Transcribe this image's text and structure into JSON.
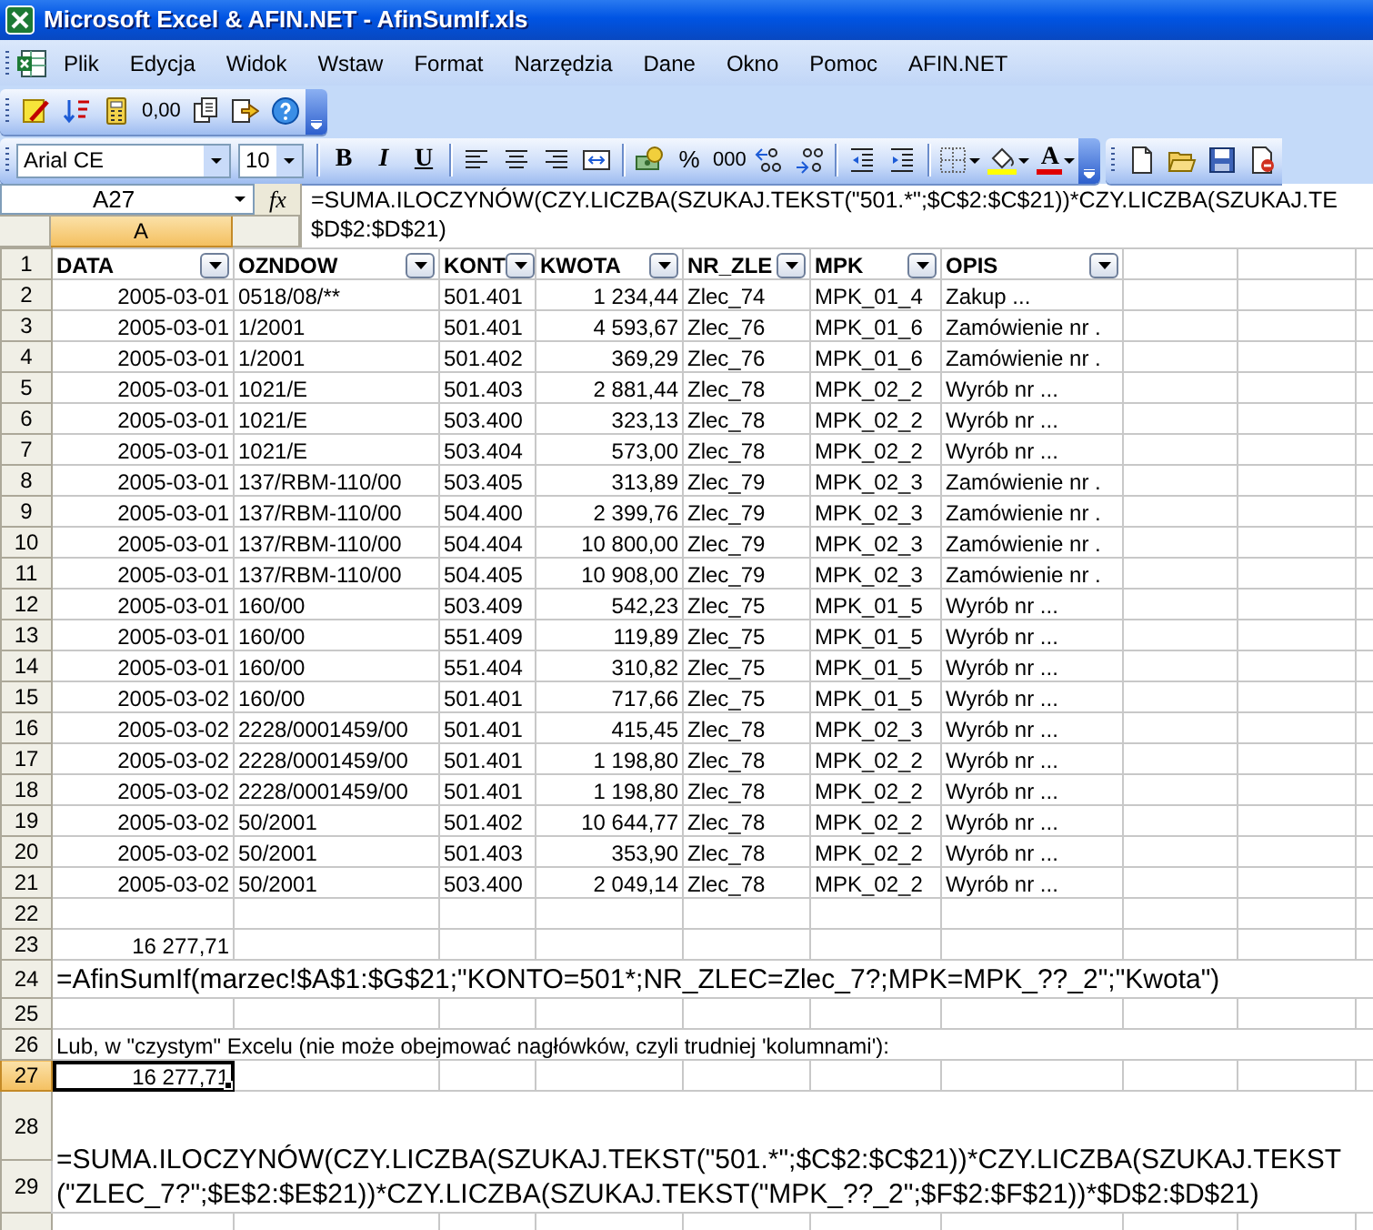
{
  "window": {
    "title": "Microsoft Excel & AFIN.NET - AfinSumIf.xls"
  },
  "menu": {
    "items": [
      "Plik",
      "Edycja",
      "Widok",
      "Wstaw",
      "Format",
      "Narzędzia",
      "Dane",
      "Okno",
      "Pomoc",
      "AFIN.NET"
    ]
  },
  "auditing_toolbar": {
    "number_format_button": "0,00"
  },
  "formatting_toolbar": {
    "font": "Arial CE",
    "font_size": "10",
    "bold_button": "B",
    "italic_button": "I",
    "underline_button": "U",
    "percent_button": "%",
    "thousands_button": "000",
    "font_color_button": "A"
  },
  "formula_bar": {
    "name_box": "A27",
    "fx_label": "fx",
    "formula_lines": [
      "=SUMA.ILOCZYNÓW(CZY.LICZBA(SZUKAJ.TEKST(\"501.*\";$C$2:$C$21))*CZY.LICZBA(SZUKAJ.TE",
      "$D$2:$D$21)"
    ]
  },
  "column_headers": [
    {
      "label": "A",
      "selected": true
    }
  ],
  "sheet": {
    "rows": [
      {
        "number": "1",
        "selected": false,
        "kind": "header",
        "cells": [
          "DATA",
          "OZNDOW",
          "KONT",
          "KWOTA",
          "NR_ZLE",
          "MPK",
          "OPIS"
        ]
      },
      {
        "number": "2",
        "selected": false,
        "kind": "data",
        "cells": [
          "2005-03-01",
          "0518/08/**",
          "501.401",
          "1 234,44",
          "Zlec_74",
          "MPK_01_4",
          "Zakup ..."
        ]
      },
      {
        "number": "3",
        "selected": false,
        "kind": "data",
        "cells": [
          "2005-03-01",
          "1/2001",
          "501.401",
          "4 593,67",
          "Zlec_76",
          "MPK_01_6",
          "Zamówienie nr ."
        ]
      },
      {
        "number": "4",
        "selected": false,
        "kind": "data",
        "cells": [
          "2005-03-01",
          "1/2001",
          "501.402",
          "369,29",
          "Zlec_76",
          "MPK_01_6",
          "Zamówienie nr ."
        ]
      },
      {
        "number": "5",
        "selected": false,
        "kind": "data",
        "cells": [
          "2005-03-01",
          "1021/E",
          "501.403",
          "2 881,44",
          "Zlec_78",
          "MPK_02_2",
          "Wyrób nr ..."
        ]
      },
      {
        "number": "6",
        "selected": false,
        "kind": "data",
        "cells": [
          "2005-03-01",
          "1021/E",
          "503.400",
          "323,13",
          "Zlec_78",
          "MPK_02_2",
          "Wyrób nr ..."
        ]
      },
      {
        "number": "7",
        "selected": false,
        "kind": "data",
        "cells": [
          "2005-03-01",
          "1021/E",
          "503.404",
          "573,00",
          "Zlec_78",
          "MPK_02_2",
          "Wyrób nr ..."
        ]
      },
      {
        "number": "8",
        "selected": false,
        "kind": "data",
        "cells": [
          "2005-03-01",
          "137/RBM-110/00",
          "503.405",
          "313,89",
          "Zlec_79",
          "MPK_02_3",
          "Zamówienie nr ."
        ]
      },
      {
        "number": "9",
        "selected": false,
        "kind": "data",
        "cells": [
          "2005-03-01",
          "137/RBM-110/00",
          "504.400",
          "2 399,76",
          "Zlec_79",
          "MPK_02_3",
          "Zamówienie nr ."
        ]
      },
      {
        "number": "10",
        "selected": false,
        "kind": "data",
        "cells": [
          "2005-03-01",
          "137/RBM-110/00",
          "504.404",
          "10 800,00",
          "Zlec_79",
          "MPK_02_3",
          "Zamówienie nr ."
        ]
      },
      {
        "number": "11",
        "selected": false,
        "kind": "data",
        "cells": [
          "2005-03-01",
          "137/RBM-110/00",
          "504.405",
          "10 908,00",
          "Zlec_79",
          "MPK_02_3",
          "Zamówienie nr ."
        ]
      },
      {
        "number": "12",
        "selected": false,
        "kind": "data",
        "cells": [
          "2005-03-01",
          "160/00",
          "503.409",
          "542,23",
          "Zlec_75",
          "MPK_01_5",
          "Wyrób nr ..."
        ]
      },
      {
        "number": "13",
        "selected": false,
        "kind": "data",
        "cells": [
          "2005-03-01",
          "160/00",
          "551.409",
          "119,89",
          "Zlec_75",
          "MPK_01_5",
          "Wyrób nr ..."
        ]
      },
      {
        "number": "14",
        "selected": false,
        "kind": "data",
        "cells": [
          "2005-03-01",
          "160/00",
          "551.404",
          "310,82",
          "Zlec_75",
          "MPK_01_5",
          "Wyrób nr ..."
        ]
      },
      {
        "number": "15",
        "selected": false,
        "kind": "data",
        "cells": [
          "2005-03-02",
          "160/00",
          "501.401",
          "717,66",
          "Zlec_75",
          "MPK_01_5",
          "Wyrób nr ..."
        ]
      },
      {
        "number": "16",
        "selected": false,
        "kind": "data",
        "cells": [
          "2005-03-02",
          "2228/0001459/00",
          "501.401",
          "415,45",
          "Zlec_78",
          "MPK_02_3",
          "Wyrób nr ..."
        ]
      },
      {
        "number": "17",
        "selected": false,
        "kind": "data",
        "cells": [
          "2005-03-02",
          "2228/0001459/00",
          "501.401",
          "1 198,80",
          "Zlec_78",
          "MPK_02_2",
          "Wyrób nr ..."
        ]
      },
      {
        "number": "18",
        "selected": false,
        "kind": "data",
        "cells": [
          "2005-03-02",
          "2228/0001459/00",
          "501.401",
          "1 198,80",
          "Zlec_78",
          "MPK_02_2",
          "Wyrób nr ..."
        ]
      },
      {
        "number": "19",
        "selected": false,
        "kind": "data",
        "cells": [
          "2005-03-02",
          "50/2001",
          "501.402",
          "10 644,77",
          "Zlec_78",
          "MPK_02_2",
          "Wyrób nr ..."
        ]
      },
      {
        "number": "20",
        "selected": false,
        "kind": "data",
        "cells": [
          "2005-03-02",
          "50/2001",
          "501.403",
          "353,90",
          "Zlec_78",
          "MPK_02_2",
          "Wyrób nr ..."
        ]
      },
      {
        "number": "21",
        "selected": false,
        "kind": "data",
        "cells": [
          "2005-03-02",
          "50/2001",
          "503.400",
          "2 049,14",
          "Zlec_78",
          "MPK_02_2",
          "Wyrób nr ..."
        ]
      },
      {
        "number": "22",
        "selected": false,
        "kind": "blank"
      },
      {
        "number": "23",
        "selected": false,
        "kind": "value",
        "text": "16 277,71"
      },
      {
        "number": "24",
        "selected": false,
        "kind": "formula",
        "text": "=AfinSumIf(marzec!$A$1:$G$21;\"KONTO=501*;NR_ZLEC=Zlec_7?;MPK=MPK_??_2\";\"Kwota\")"
      },
      {
        "number": "25",
        "selected": false,
        "kind": "blank"
      },
      {
        "number": "26",
        "selected": false,
        "kind": "note",
        "text": "Lub, w \"czystym\" Excelu (nie może obejmować nagłówków, czyli trudniej 'kolumnami'):"
      },
      {
        "number": "27",
        "selected": true,
        "kind": "value",
        "text": "16 277,71"
      },
      {
        "number": "28",
        "selected": false,
        "kind": "wrapped",
        "text": "=SUMA.ILOCZYNÓW(CZY.LICZBA(SZUKAJ.TEKST(\"501.*\";$C$2:$C$21))*CZY.LICZBA(SZUKAJ.TEKST(\"ZLEC_7?\";$E$2:$E$21))*CZY.LICZBA(SZUKAJ.TEKST(\"MPK_??_2\";$F$2:$F$21))*$D$2:$D$21)"
      },
      {
        "number": "29",
        "selected": false,
        "kind": "merged"
      }
    ]
  }
}
